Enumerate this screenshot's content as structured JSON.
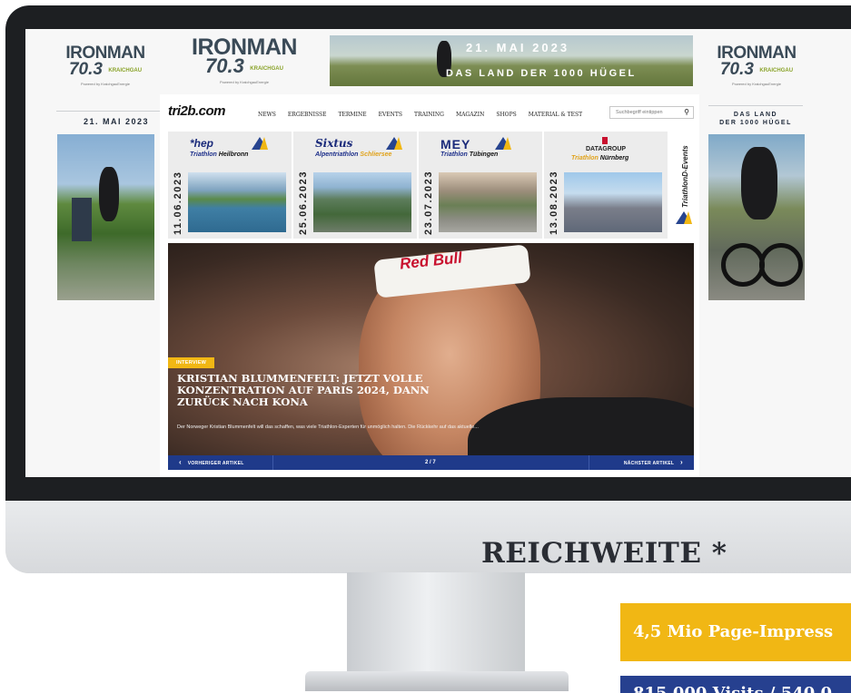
{
  "reach": {
    "title": "REICHWEITE",
    "asterisk": "*",
    "stat_page_impressions": "4,5 Mio Page-Impress",
    "stat_visits": "815.000 Visits / 540.0"
  },
  "ads": {
    "left": {
      "brand": "IRONMAN",
      "model": "70.3",
      "sub": "KRAICHGAU",
      "powered": "Powered by KraichgauEnergie",
      "date": "21. MAI 2023"
    },
    "top_left": {
      "brand": "IRONMAN",
      "model": "70.3",
      "sub": "KRAICHGAU",
      "powered": "Powered by KraichgauEnergie"
    },
    "top_banner": {
      "date": "21. MAI 2023",
      "tagline": "DAS LAND DER 1000 HÜGEL"
    },
    "right": {
      "brand": "IRONMAN",
      "model": "70.3",
      "sub": "KRAICHGAU",
      "powered": "Powered by KraichgauEnergie",
      "line1": "DAS LAND",
      "line2": "DER 1000 HÜGEL"
    }
  },
  "site": {
    "logo": "tri2b.com",
    "nav": [
      "NEWS",
      "ERGEBNISSE",
      "TERMINE",
      "EVENTS",
      "TRAINING",
      "MAGAZIN",
      "SHOPS",
      "MATERIAL & TEST"
    ],
    "search_placeholder": "Suchbegriff eintippen",
    "events": [
      {
        "date": "11.06.2023",
        "brand": "*hep",
        "title_a": "Triathlon",
        "title_b": "Heilbronn"
      },
      {
        "date": "25.06.2023",
        "brand": "Sixtus",
        "title_a": "Alpentriathlon",
        "title_b": "Schliersee"
      },
      {
        "date": "23.07.2023",
        "brand": "MEY",
        "title_a": "Triathlon",
        "title_b": "Tübingen"
      },
      {
        "date": "13.08.2023",
        "brand": "DATAGROUP",
        "title_a": "Triathlon",
        "title_b": "Nürnberg"
      }
    ],
    "events_tag": "TriathlonD-Events",
    "hero": {
      "badge": "INTERVIEW",
      "headband": "Red Bull",
      "title": "KRISTIAN BLUMMENFELT: JETZT VOLLE KONZENTRATION AUF PARIS 2024, DANN ZURÜCK NACH KONA",
      "text": "Der Norweger Kristian Blummenfelt will das schaffen, was viele Triathlon-Experten für unmöglich halten. Die Rückkehr auf das aktuelle...",
      "prev": "VORHERIGER ARTIKEL",
      "next": "NÄCHSTER ARTIKEL",
      "count": "2 / 7"
    }
  },
  "colors": {
    "accent_yellow": "#f1b714",
    "accent_blue": "#26408f",
    "monitor_bezel": "#1d1f22"
  }
}
